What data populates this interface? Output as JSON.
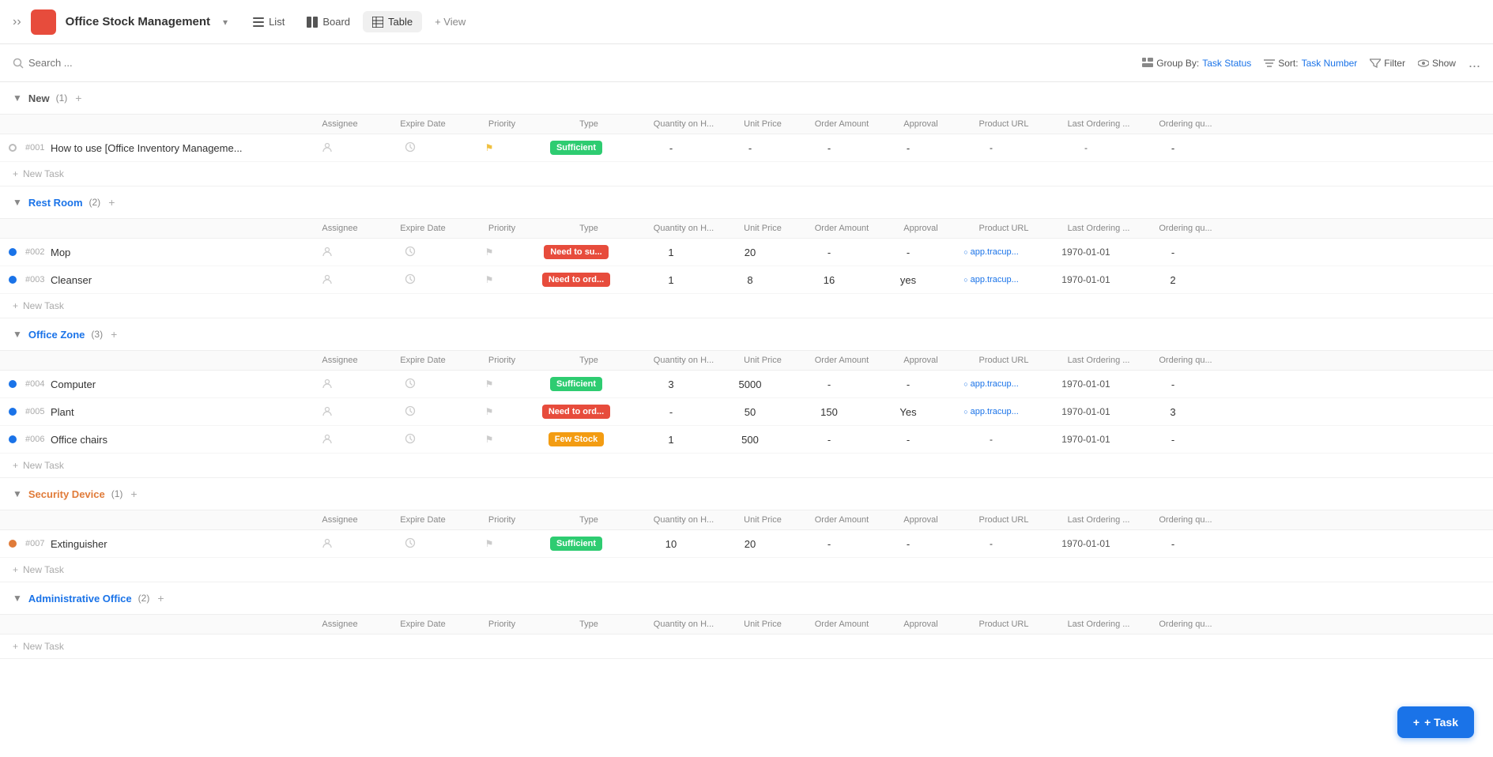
{
  "header": {
    "menu_icon": "≡",
    "app_title": "Office Stock Management",
    "app_title_arrow": "▾",
    "tabs": [
      {
        "id": "list",
        "label": "List",
        "icon": "list",
        "active": false
      },
      {
        "id": "board",
        "label": "Board",
        "icon": "board",
        "active": false
      },
      {
        "id": "table",
        "label": "Table",
        "icon": "table",
        "active": true
      }
    ],
    "add_view": "+ View"
  },
  "search": {
    "placeholder": "Search ...",
    "group_by_label": "Group By:",
    "group_by_value": "Task Status",
    "sort_label": "Sort:",
    "sort_value": "Task Number",
    "filter_label": "Filter",
    "show_label": "Show",
    "more": "..."
  },
  "columns": {
    "assignee": "Assignee",
    "expire_date": "Expire Date",
    "priority": "Priority",
    "type": "Type",
    "quantity": "Quantity on H...",
    "unit_price": "Unit Price",
    "order_amount": "Order Amount",
    "approval": "Approval",
    "product_url": "Product URL",
    "last_ordering": "Last Ordering ...",
    "ordering_qty": "Ordering qu..."
  },
  "sections": [
    {
      "id": "new",
      "title": "New",
      "color": "gray",
      "count": 1,
      "collapsed": false,
      "tasks": [
        {
          "id": "#001",
          "dot_color": "gray",
          "name": "How to use [Office Inventory Manageme...",
          "assignee": "",
          "expire_date": "",
          "priority": "flag",
          "type_badge": "Sufficient",
          "type_class": "sufficient",
          "quantity": "-",
          "unit_price": "-",
          "order_amount": "-",
          "approval": "-",
          "product_url": "-",
          "last_ordering": "-",
          "ordering_qty": "-"
        }
      ]
    },
    {
      "id": "rest-room",
      "title": "Rest Room",
      "color": "blue",
      "count": 2,
      "collapsed": false,
      "tasks": [
        {
          "id": "#002",
          "dot_color": "blue",
          "name": "Mop",
          "assignee": "",
          "expire_date": "",
          "priority": "",
          "type_badge": "Need to su...",
          "type_class": "need-su",
          "quantity": "1",
          "unit_price": "20",
          "order_amount": "-",
          "approval": "-",
          "product_url": "app.tracup...",
          "last_ordering": "1970-01-01",
          "ordering_qty": "-"
        },
        {
          "id": "#003",
          "dot_color": "blue",
          "name": "Cleanser",
          "assignee": "",
          "expire_date": "",
          "priority": "",
          "type_badge": "Need to ord...",
          "type_class": "need-ord",
          "quantity": "1",
          "unit_price": "8",
          "order_amount": "16",
          "approval": "yes",
          "product_url": "app.tracup...",
          "last_ordering": "1970-01-01",
          "ordering_qty": "2"
        }
      ]
    },
    {
      "id": "office-zone",
      "title": "Office Zone",
      "color": "blue",
      "count": 3,
      "collapsed": false,
      "tasks": [
        {
          "id": "#004",
          "dot_color": "blue",
          "name": "Computer",
          "assignee": "",
          "expire_date": "",
          "priority": "",
          "type_badge": "Sufficient",
          "type_class": "sufficient",
          "quantity": "3",
          "unit_price": "5000",
          "order_amount": "-",
          "approval": "-",
          "product_url": "app.tracup...",
          "last_ordering": "1970-01-01",
          "ordering_qty": "-"
        },
        {
          "id": "#005",
          "dot_color": "blue",
          "name": "Plant",
          "assignee": "",
          "expire_date": "",
          "priority": "",
          "type_badge": "Need to ord...",
          "type_class": "need-ord",
          "quantity": "-",
          "unit_price": "50",
          "order_amount": "150",
          "approval": "Yes",
          "product_url": "app.tracup...",
          "last_ordering": "1970-01-01",
          "ordering_qty": "3"
        },
        {
          "id": "#006",
          "dot_color": "blue",
          "name": "Office chairs",
          "assignee": "",
          "expire_date": "",
          "priority": "",
          "type_badge": "Few Stock",
          "type_class": "few",
          "quantity": "1",
          "unit_price": "500",
          "order_amount": "-",
          "approval": "-",
          "product_url": "-",
          "last_ordering": "1970-01-01",
          "ordering_qty": "-"
        }
      ]
    },
    {
      "id": "security-device",
      "title": "Security Device",
      "color": "orange",
      "count": 1,
      "collapsed": false,
      "tasks": [
        {
          "id": "#007",
          "dot_color": "orange",
          "name": "Extinguisher",
          "assignee": "",
          "expire_date": "",
          "priority": "",
          "type_badge": "Sufficient",
          "type_class": "sufficient",
          "quantity": "10",
          "unit_price": "20",
          "order_amount": "-",
          "approval": "-",
          "product_url": "-",
          "last_ordering": "1970-01-01",
          "ordering_qty": "-"
        }
      ]
    },
    {
      "id": "administrative-office",
      "title": "Administrative Office",
      "color": "blue",
      "count": 2,
      "collapsed": false,
      "tasks": []
    }
  ],
  "add_task_btn": "+ Task",
  "new_task_label": "+ New Task"
}
